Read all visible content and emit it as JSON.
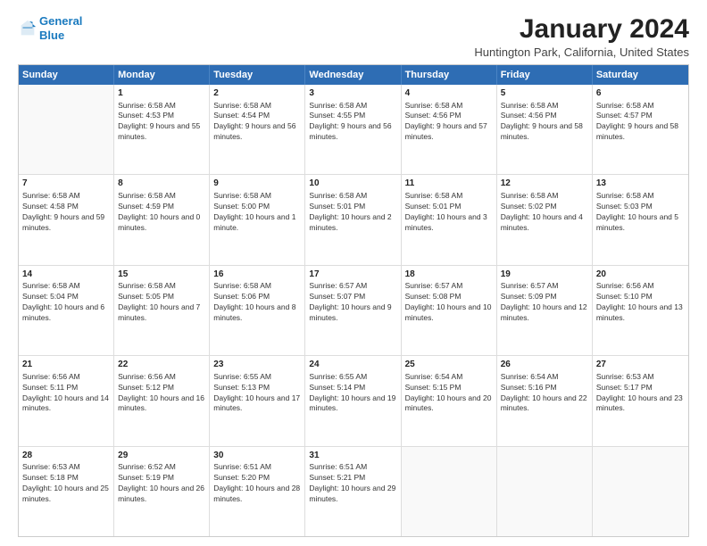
{
  "logo": {
    "line1": "General",
    "line2": "Blue",
    "icon_color": "#1a7abf"
  },
  "title": "January 2024",
  "location": "Huntington Park, California, United States",
  "header_days": [
    "Sunday",
    "Monday",
    "Tuesday",
    "Wednesday",
    "Thursday",
    "Friday",
    "Saturday"
  ],
  "weeks": [
    [
      {
        "day": "",
        "sunrise": "",
        "sunset": "",
        "daylight": ""
      },
      {
        "day": "1",
        "sunrise": "6:58 AM",
        "sunset": "4:53 PM",
        "daylight": "9 hours and 55 minutes."
      },
      {
        "day": "2",
        "sunrise": "6:58 AM",
        "sunset": "4:54 PM",
        "daylight": "9 hours and 56 minutes."
      },
      {
        "day": "3",
        "sunrise": "6:58 AM",
        "sunset": "4:55 PM",
        "daylight": "9 hours and 56 minutes."
      },
      {
        "day": "4",
        "sunrise": "6:58 AM",
        "sunset": "4:56 PM",
        "daylight": "9 hours and 57 minutes."
      },
      {
        "day": "5",
        "sunrise": "6:58 AM",
        "sunset": "4:56 PM",
        "daylight": "9 hours and 58 minutes."
      },
      {
        "day": "6",
        "sunrise": "6:58 AM",
        "sunset": "4:57 PM",
        "daylight": "9 hours and 58 minutes."
      }
    ],
    [
      {
        "day": "7",
        "sunrise": "6:58 AM",
        "sunset": "4:58 PM",
        "daylight": "9 hours and 59 minutes."
      },
      {
        "day": "8",
        "sunrise": "6:58 AM",
        "sunset": "4:59 PM",
        "daylight": "10 hours and 0 minutes."
      },
      {
        "day": "9",
        "sunrise": "6:58 AM",
        "sunset": "5:00 PM",
        "daylight": "10 hours and 1 minute."
      },
      {
        "day": "10",
        "sunrise": "6:58 AM",
        "sunset": "5:01 PM",
        "daylight": "10 hours and 2 minutes."
      },
      {
        "day": "11",
        "sunrise": "6:58 AM",
        "sunset": "5:01 PM",
        "daylight": "10 hours and 3 minutes."
      },
      {
        "day": "12",
        "sunrise": "6:58 AM",
        "sunset": "5:02 PM",
        "daylight": "10 hours and 4 minutes."
      },
      {
        "day": "13",
        "sunrise": "6:58 AM",
        "sunset": "5:03 PM",
        "daylight": "10 hours and 5 minutes."
      }
    ],
    [
      {
        "day": "14",
        "sunrise": "6:58 AM",
        "sunset": "5:04 PM",
        "daylight": "10 hours and 6 minutes."
      },
      {
        "day": "15",
        "sunrise": "6:58 AM",
        "sunset": "5:05 PM",
        "daylight": "10 hours and 7 minutes."
      },
      {
        "day": "16",
        "sunrise": "6:58 AM",
        "sunset": "5:06 PM",
        "daylight": "10 hours and 8 minutes."
      },
      {
        "day": "17",
        "sunrise": "6:57 AM",
        "sunset": "5:07 PM",
        "daylight": "10 hours and 9 minutes."
      },
      {
        "day": "18",
        "sunrise": "6:57 AM",
        "sunset": "5:08 PM",
        "daylight": "10 hours and 10 minutes."
      },
      {
        "day": "19",
        "sunrise": "6:57 AM",
        "sunset": "5:09 PM",
        "daylight": "10 hours and 12 minutes."
      },
      {
        "day": "20",
        "sunrise": "6:56 AM",
        "sunset": "5:10 PM",
        "daylight": "10 hours and 13 minutes."
      }
    ],
    [
      {
        "day": "21",
        "sunrise": "6:56 AM",
        "sunset": "5:11 PM",
        "daylight": "10 hours and 14 minutes."
      },
      {
        "day": "22",
        "sunrise": "6:56 AM",
        "sunset": "5:12 PM",
        "daylight": "10 hours and 16 minutes."
      },
      {
        "day": "23",
        "sunrise": "6:55 AM",
        "sunset": "5:13 PM",
        "daylight": "10 hours and 17 minutes."
      },
      {
        "day": "24",
        "sunrise": "6:55 AM",
        "sunset": "5:14 PM",
        "daylight": "10 hours and 19 minutes."
      },
      {
        "day": "25",
        "sunrise": "6:54 AM",
        "sunset": "5:15 PM",
        "daylight": "10 hours and 20 minutes."
      },
      {
        "day": "26",
        "sunrise": "6:54 AM",
        "sunset": "5:16 PM",
        "daylight": "10 hours and 22 minutes."
      },
      {
        "day": "27",
        "sunrise": "6:53 AM",
        "sunset": "5:17 PM",
        "daylight": "10 hours and 23 minutes."
      }
    ],
    [
      {
        "day": "28",
        "sunrise": "6:53 AM",
        "sunset": "5:18 PM",
        "daylight": "10 hours and 25 minutes."
      },
      {
        "day": "29",
        "sunrise": "6:52 AM",
        "sunset": "5:19 PM",
        "daylight": "10 hours and 26 minutes."
      },
      {
        "day": "30",
        "sunrise": "6:51 AM",
        "sunset": "5:20 PM",
        "daylight": "10 hours and 28 minutes."
      },
      {
        "day": "31",
        "sunrise": "6:51 AM",
        "sunset": "5:21 PM",
        "daylight": "10 hours and 29 minutes."
      },
      {
        "day": "",
        "sunrise": "",
        "sunset": "",
        "daylight": ""
      },
      {
        "day": "",
        "sunrise": "",
        "sunset": "",
        "daylight": ""
      },
      {
        "day": "",
        "sunrise": "",
        "sunset": "",
        "daylight": ""
      }
    ]
  ],
  "labels": {
    "sunrise_prefix": "Sunrise: ",
    "sunset_prefix": "Sunset: ",
    "daylight_prefix": "Daylight: "
  }
}
